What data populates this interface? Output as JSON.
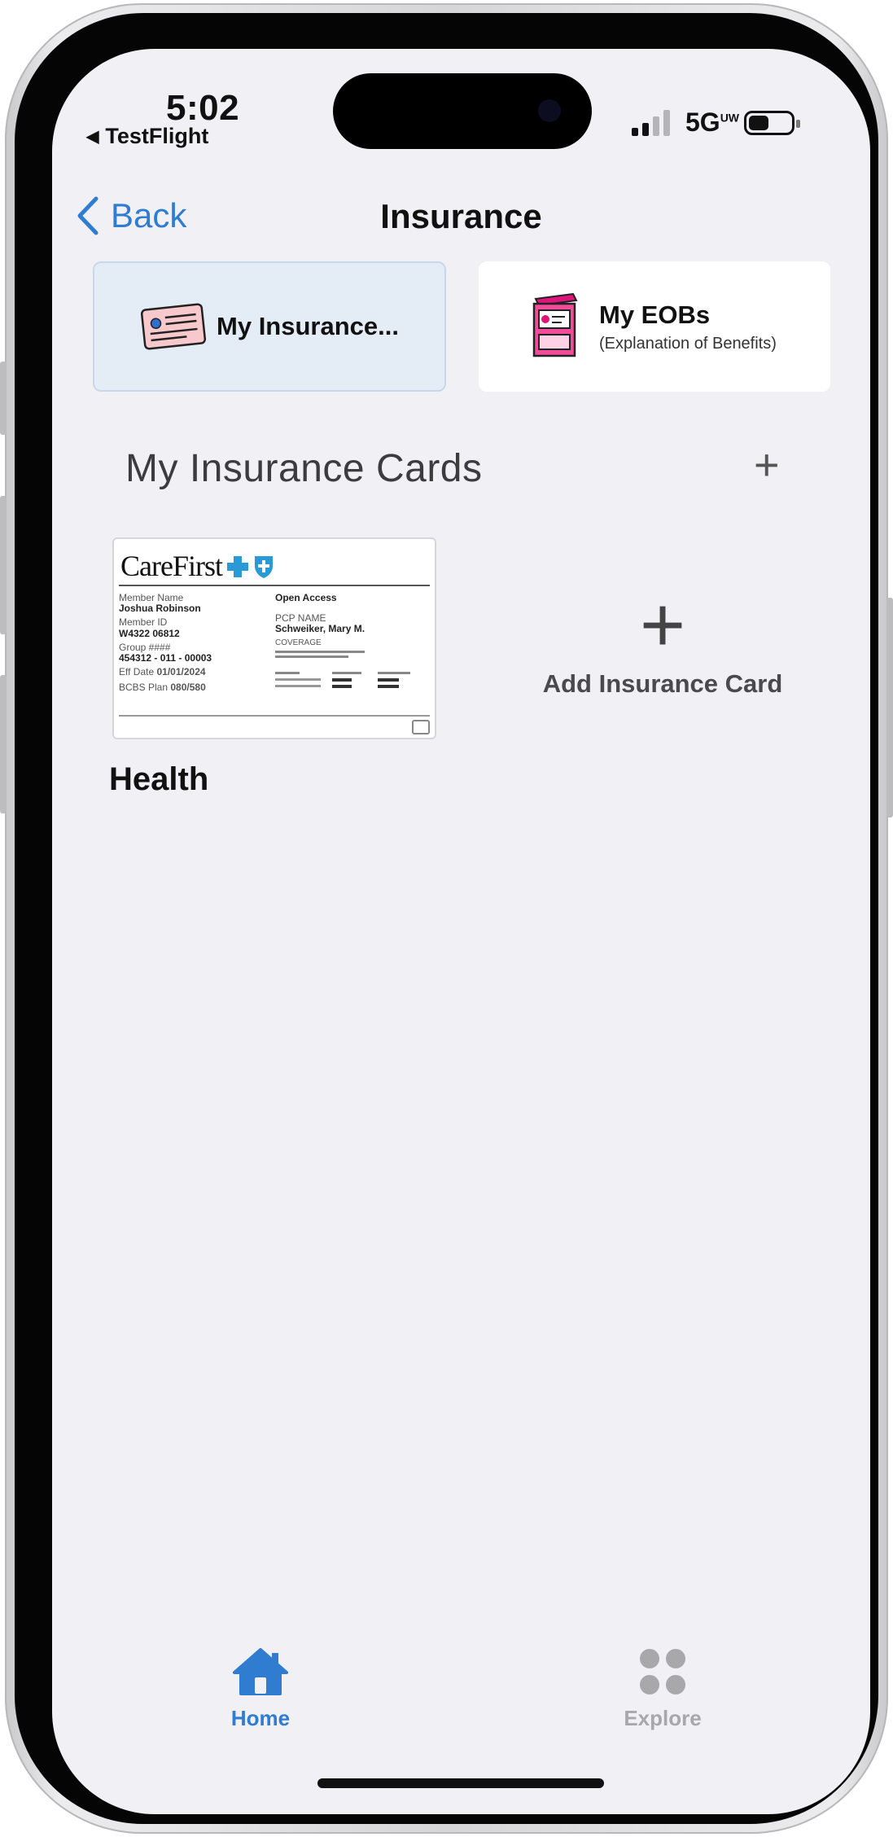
{
  "status_bar": {
    "time": "5:02",
    "back_app": "TestFlight",
    "network": "5G",
    "network_suffix": "UW"
  },
  "nav": {
    "back_label": "Back",
    "title": "Insurance"
  },
  "segments": [
    {
      "label": "My Insurance...",
      "selected": true
    },
    {
      "label": "My EOBs",
      "sublabel": "(Explanation of Benefits)",
      "selected": false
    }
  ],
  "section": {
    "title": "My Insurance Cards",
    "add_symbol": "+"
  },
  "cards": [
    {
      "brand": "CareFirst",
      "member_name_label": "Member Name",
      "member_name": "Joshua Robinson",
      "member_id_label": "Member ID",
      "member_id": "W4322 06812",
      "group_label": "Group ####",
      "group": "454312 - 011 - 00003",
      "eff_date_label": "Eff Date",
      "eff_date": "01/01/2024",
      "bcbs_plan_label": "BCBS Plan",
      "bcbs_plan": "080/580",
      "plan_type": "Open Access",
      "pcp_label": "PCP NAME",
      "pcp": "Schweiker, Mary M.",
      "coverage_label": "COVERAGE",
      "caption": "Health"
    }
  ],
  "add_card": {
    "symbol": "+",
    "label": "Add Insurance Card"
  },
  "tabs": [
    {
      "label": "Home",
      "active": true
    },
    {
      "label": "Explore",
      "active": false
    }
  ],
  "colors": {
    "accent": "#2f7cd1",
    "background": "#f1f0f5",
    "active_tile": "#e4ecf6",
    "inactive_tab": "#a8a8ab"
  }
}
